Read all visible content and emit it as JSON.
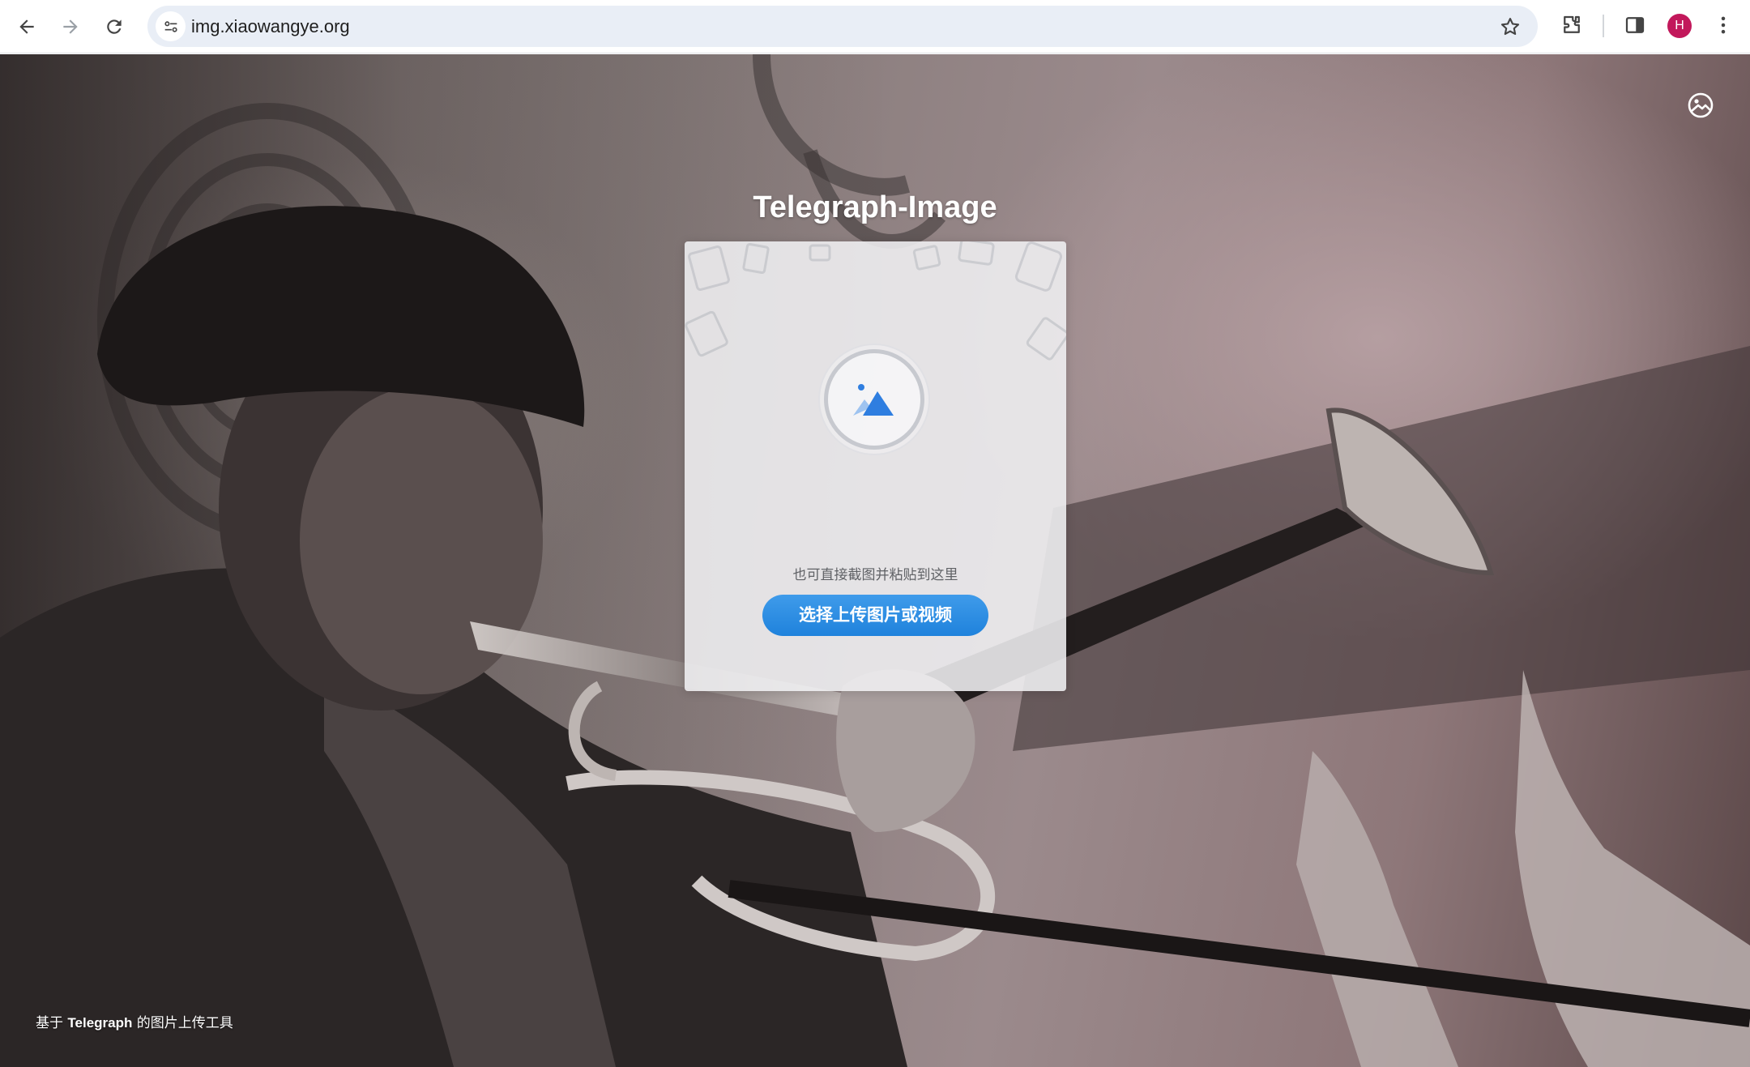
{
  "browser": {
    "url": "img.xiaowangye.org",
    "avatar_letter": "H",
    "avatar_color": "#c2185b",
    "icons": [
      "back-icon",
      "forward-icon",
      "reload-icon",
      "site-info-icon",
      "bookmark-star-icon",
      "extensions-icon",
      "side-panel-icon",
      "menu-kebab-icon"
    ]
  },
  "page": {
    "title": "Telegraph-Image",
    "paste_hint": "也可直接截图并粘贴到这里",
    "upload_button": "选择上传图片或视频",
    "footer": {
      "prefix": "基于",
      "brand": "Telegraph",
      "suffix": "的图片上传工具"
    },
    "accent_color": "#2a8ce3"
  }
}
